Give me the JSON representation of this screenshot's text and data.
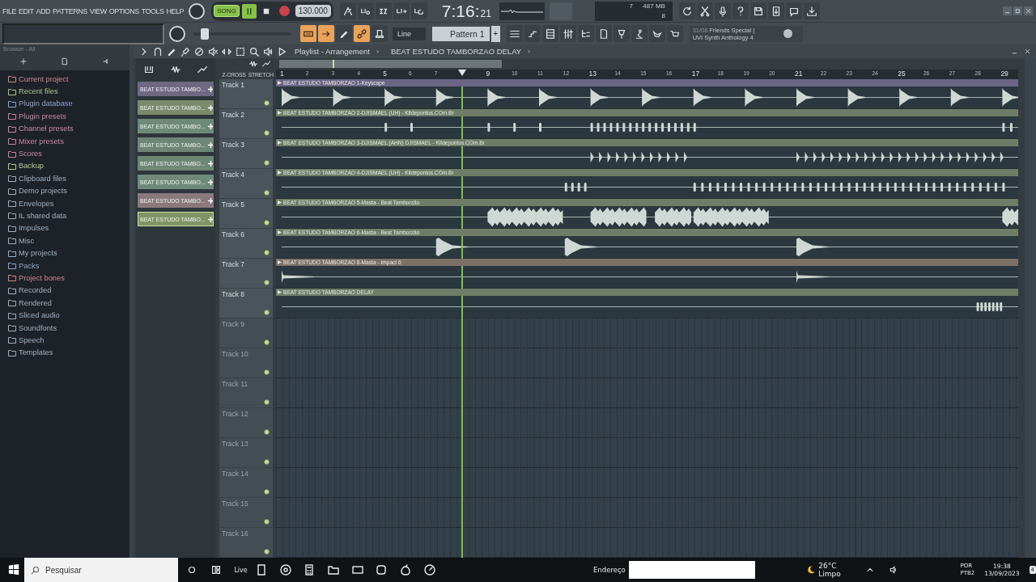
{
  "menu": [
    "FILE",
    "EDIT",
    "ADD",
    "PATTERNS",
    "VIEW",
    "OPTIONS",
    "TOOLS",
    "HELP"
  ],
  "transport": {
    "mode": "SONG",
    "tempo": "130.000",
    "time": "7:16:",
    "time_ticks": "21"
  },
  "master": {
    "level": 0.08
  },
  "monitor": {
    "cpu": "7",
    "memory": "487 MB",
    "polyphony": "8"
  },
  "snap": "Line",
  "pattern": "Pattern 1",
  "add_pattern": "+",
  "news": {
    "date": "31/08",
    "title": "Friends Special |",
    "subtitle": "UVI Synth Anthology 4"
  },
  "browser": {
    "title": "Browser - All",
    "items": [
      {
        "label": "Current project",
        "color": "#c98a8f"
      },
      {
        "label": "Recent files",
        "color": "#a9c48f"
      },
      {
        "label": "Plugin database",
        "color": "#8fa2c9"
      },
      {
        "label": "Plugin presets",
        "color": "#c587a8"
      },
      {
        "label": "Channel presets",
        "color": "#c587a8"
      },
      {
        "label": "Mixer presets",
        "color": "#c587a8"
      },
      {
        "label": "Scores",
        "color": "#c587a8"
      },
      {
        "label": "Backup",
        "color": "#b6c98f"
      },
      {
        "label": "Clipboard files",
        "color": "#9fb0bf"
      },
      {
        "label": "Demo projects",
        "color": "#9fb0bf"
      },
      {
        "label": "Envelopes",
        "color": "#9fb0bf"
      },
      {
        "label": "IL shared data",
        "color": "#9fb0bf"
      },
      {
        "label": "Impulses",
        "color": "#9fb0bf"
      },
      {
        "label": "Misc",
        "color": "#9fb0bf"
      },
      {
        "label": "My projects",
        "color": "#9fb0bf"
      },
      {
        "label": "Packs",
        "color": "#8fa2c9"
      },
      {
        "label": "Project bones",
        "color": "#c98a8f"
      },
      {
        "label": "Recorded",
        "color": "#9fb0bf"
      },
      {
        "label": "Rendered",
        "color": "#9fb0bf"
      },
      {
        "label": "Sliced audio",
        "color": "#9fb0bf"
      },
      {
        "label": "Soundfonts",
        "color": "#9fb0bf"
      },
      {
        "label": "Speech",
        "color": "#9fb0bf"
      },
      {
        "label": "Templates",
        "color": "#9fb0bf"
      }
    ]
  },
  "patterns": [
    {
      "label": "BEAT ESTUDO TAMBO...",
      "color": "#6e6883",
      "selected": false
    },
    {
      "label": "BEAT ESTUDO TAMBO...",
      "color": "#7b8a6c",
      "selected": false
    },
    {
      "label": "BEAT ESTUDO TAMBO...",
      "color": "#6f8a78",
      "selected": false
    },
    {
      "label": "BEAT ESTUDO TAMBO...",
      "color": "#6f8577",
      "selected": false
    },
    {
      "label": "BEAT ESTUDO TAMBO...",
      "color": "#6e8674",
      "selected": false
    },
    {
      "label": "BEAT ESTUDO TAMBO...",
      "color": "#6f8a7a",
      "selected": false
    },
    {
      "label": "BEAT ESTUDO TAMBO...",
      "color": "#8a787c",
      "selected": false
    },
    {
      "label": "BEAT ESTUDO TAMBO...",
      "color": "#7f9466",
      "selected": true
    }
  ],
  "playlist": {
    "title": "Playlist - Arrangement",
    "current": "BEAT ESTUDO TAMBORZAO DELAY",
    "options": [
      "Z-CROSS",
      "STRETCH"
    ],
    "bars": [
      {
        "kind": "bar",
        "label": "1",
        "major": true
      },
      {
        "kind": "bar",
        "label": "2",
        "major": false
      },
      {
        "kind": "bar",
        "label": "3",
        "major": false
      },
      {
        "kind": "bar",
        "label": "4",
        "major": false
      },
      {
        "kind": "bar",
        "label": "5",
        "major": true
      },
      {
        "kind": "bar",
        "label": "6",
        "major": false
      },
      {
        "kind": "bar",
        "label": "7",
        "major": false
      },
      {
        "kind": "playhead"
      },
      {
        "kind": "bar",
        "label": "9",
        "major": true
      },
      {
        "kind": "bar",
        "label": "10",
        "major": false
      },
      {
        "kind": "bar",
        "label": "11",
        "major": false
      },
      {
        "kind": "bar",
        "label": "12",
        "major": false
      },
      {
        "kind": "bar",
        "label": "13",
        "major": true
      },
      {
        "kind": "bar",
        "label": "14",
        "major": false
      },
      {
        "kind": "bar",
        "label": "15",
        "major": false
      },
      {
        "kind": "bar",
        "label": "16",
        "major": false
      },
      {
        "kind": "bar",
        "label": "17",
        "major": true
      },
      {
        "kind": "bar",
        "label": "18",
        "major": false
      },
      {
        "kind": "bar",
        "label": "19",
        "major": false
      },
      {
        "kind": "bar",
        "label": "20",
        "major": false
      },
      {
        "kind": "bar",
        "label": "21",
        "major": true
      },
      {
        "kind": "bar",
        "label": "22",
        "major": false
      },
      {
        "kind": "bar",
        "label": "23",
        "major": false
      },
      {
        "kind": "bar",
        "label": "24",
        "major": false
      },
      {
        "kind": "bar",
        "label": "25",
        "major": true
      },
      {
        "kind": "bar",
        "label": "26",
        "major": false
      },
      {
        "kind": "bar",
        "label": "27",
        "major": false
      },
      {
        "kind": "bar",
        "label": "28",
        "major": false
      },
      {
        "kind": "bar",
        "label": "29",
        "major": true
      }
    ],
    "tracks": [
      {
        "name": "Track 1",
        "dimmed": false,
        "clip": {
          "label": "BEAT ESTUDO TAMBORZAO 1-Keyscape",
          "color": "#6b6585"
        }
      },
      {
        "name": "Track 2",
        "dimmed": false,
        "clip": {
          "label": "BEAT ESTUDO TAMBORZAO 2-DJISMAEL (UH) - Kitdepontos.COm.Br",
          "color": "#6f7d68"
        }
      },
      {
        "name": "Track 3",
        "dimmed": false,
        "clip": {
          "label": "BEAT ESTUDO TAMBORZAO 3-DJISMAEL (AHN) DJISMAEL - Kitdepontos.COm.Br",
          "color": "#6f7d68"
        }
      },
      {
        "name": "Track 4",
        "dimmed": false,
        "clip": {
          "label": "BEAT ESTUDO TAMBORZAO 4-DJISMAEL (UH) - Kitdepontos.COm.Br",
          "color": "#6f7d68"
        }
      },
      {
        "name": "Track 5",
        "dimmed": false,
        "clip": {
          "label": "BEAT ESTUDO TAMBORZAO 5-Masta - Beat Tamborzão",
          "color": "#6f7d68"
        }
      },
      {
        "name": "Track 6",
        "dimmed": false,
        "clip": {
          "label": "BEAT ESTUDO TAMBORZAO 6-Masta - Beat Tamborzão",
          "color": "#6f7d68"
        }
      },
      {
        "name": "Track 7",
        "dimmed": false,
        "clip": {
          "label": "BEAT ESTUDO TAMBORZAO 8-Masta - Impact 6",
          "color": "#7b7167"
        }
      },
      {
        "name": "Track 8",
        "dimmed": false,
        "clip": {
          "label": "BEAT ESTUDO TAMBORZAO DELAY",
          "color": "#6f7d68"
        }
      },
      {
        "name": "Track 9",
        "dimmed": true
      },
      {
        "name": "Track 10",
        "dimmed": true
      },
      {
        "name": "Track 11",
        "dimmed": true
      },
      {
        "name": "Track 12",
        "dimmed": true
      },
      {
        "name": "Track 13",
        "dimmed": true
      },
      {
        "name": "Track 14",
        "dimmed": true
      },
      {
        "name": "Track 15",
        "dimmed": true
      },
      {
        "name": "Track 16",
        "dimmed": true
      }
    ]
  },
  "taskbar": {
    "search": {
      "placeholder": "Pesquisar"
    },
    "live": "Live",
    "address_label": "Endereço",
    "weather": "26°C Limpo",
    "language": "POR",
    "layout": "PTB2",
    "time": "19:38",
    "date": "13/09/2023",
    "notifications": "4"
  }
}
